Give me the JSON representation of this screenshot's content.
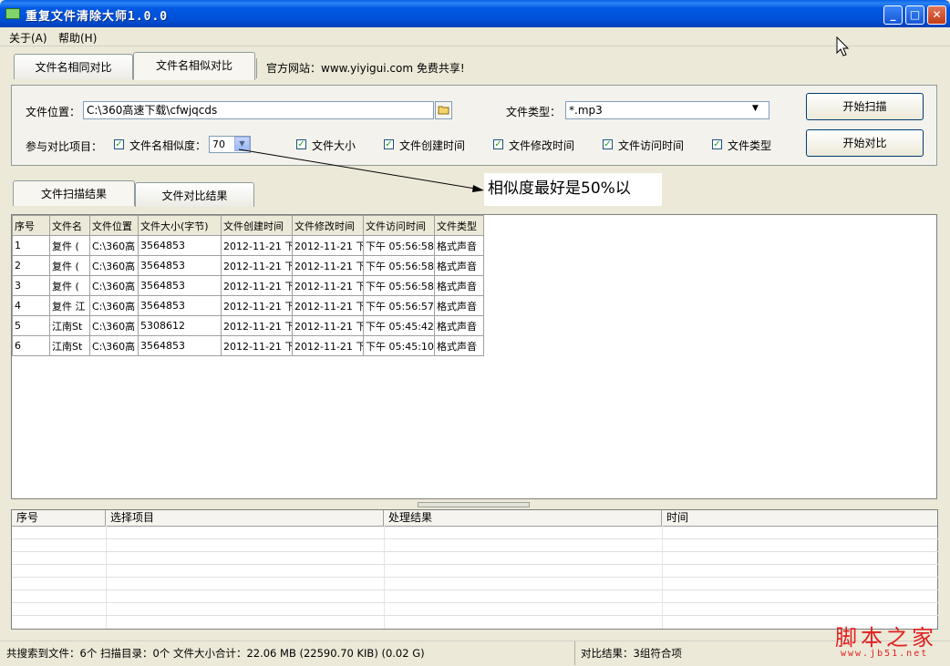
{
  "window": {
    "title": "重复文件清除大师1.0.0"
  },
  "menu": [
    {
      "label": "关于(A)"
    },
    {
      "label": "帮助(H)"
    }
  ],
  "top_tabs": [
    {
      "label": "文件名相同对比"
    },
    {
      "label": "文件名相似对比"
    }
  ],
  "website": {
    "text": "官方网站：www.yiyigui.com 免费共享!"
  },
  "form": {
    "location_label": "文件位置：",
    "location_value": "C:\\360高速下载\\cfwjqcds",
    "filetype_label": "文件类型：",
    "filetype_value": "*.mp3",
    "compare_label": "参与对比项目：",
    "similarity_label": "文件名相似度：",
    "similarity_value": "70",
    "options": [
      {
        "label": "文件大小",
        "checked": true
      },
      {
        "label": "文件创建时间",
        "checked": true
      },
      {
        "label": "文件修改时间",
        "checked": true
      },
      {
        "label": "文件访问时间",
        "checked": true
      },
      {
        "label": "文件类型",
        "checked": true
      }
    ],
    "scan_button": "开始扫描",
    "compare_button": "开始对比"
  },
  "result_tabs": [
    {
      "label": "文件扫描结果"
    },
    {
      "label": "文件对比结果"
    }
  ],
  "annotation": {
    "text": "相似度最好是50%以"
  },
  "scan_table": {
    "columns": [
      "序号",
      "文件名",
      "文件位置",
      "文件大小(字节)",
      "文件创建时间",
      "文件修改时间",
      "文件访问时间",
      "文件类型"
    ],
    "rows": [
      [
        "1",
        "复件 (",
        "C:\\360高",
        "3564853",
        "2012-11-21 下",
        "2012-11-21 下",
        "下午 05:56:58",
        "格式声音"
      ],
      [
        "2",
        "复件 (",
        "C:\\360高",
        "3564853",
        "2012-11-21 下",
        "2012-11-21 下",
        "下午 05:56:58",
        "格式声音"
      ],
      [
        "3",
        "复件 (",
        "C:\\360高",
        "3564853",
        "2012-11-21 下",
        "2012-11-21 下",
        "下午 05:56:58",
        "格式声音"
      ],
      [
        "4",
        "复件 江",
        "C:\\360高",
        "3564853",
        "2012-11-21 下",
        "2012-11-21 下",
        "下午 05:56:57",
        "格式声音"
      ],
      [
        "5",
        "江南St",
        "C:\\360高",
        "5308612",
        "2012-11-21 下",
        "2012-11-21 下",
        "下午 05:45:42",
        "格式声音"
      ],
      [
        "6",
        "江南St",
        "C:\\360高",
        "3564853",
        "2012-11-21 下",
        "2012-11-21 下",
        "下午 05:45:10",
        "格式声音"
      ]
    ]
  },
  "process_table": {
    "columns": [
      "序号",
      "选择项目",
      "处理结果",
      "时间"
    ]
  },
  "status": {
    "left": "共搜索到文件：6个  扫描目录：0个  文件大小合计：22.06 MB (22590.70 KIB) (0.02 G)",
    "right": "对比结果：3组符合项"
  },
  "watermark": {
    "main": "脚本之家",
    "sub": "www.jb51.net"
  },
  "colors": {
    "titlebar": "#0058e4",
    "window_bg": "#ece9d8",
    "watermark": "#e02020"
  }
}
